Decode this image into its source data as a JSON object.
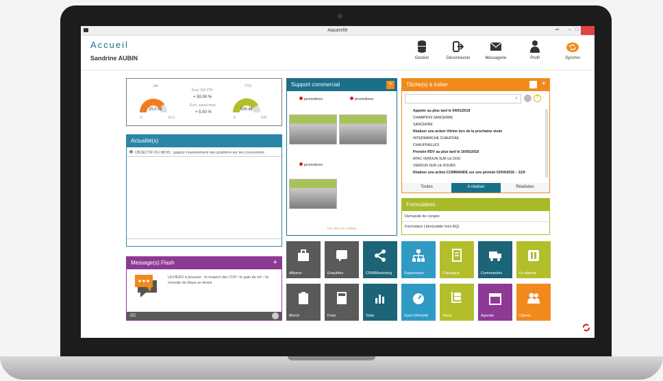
{
  "window": {
    "title": "Aquarelle"
  },
  "header": {
    "title": "Accueil",
    "user": "Sandrine AUBIN"
  },
  "toolbar": [
    {
      "label": "Gestion",
      "icon": "database-icon"
    },
    {
      "label": "Déconnexion",
      "icon": "logout-icon"
    },
    {
      "label": "Messagerie",
      "icon": "mail-icon"
    },
    {
      "label": "Profil",
      "icon": "user-icon"
    },
    {
      "label": "Synchro",
      "icon": "sync-icon"
    }
  ],
  "gauges": {
    "left": {
      "top_label": "14k",
      "value": "25.0 k€",
      "min": "0",
      "max": "31.0",
      "fraction": 0.8,
      "color": "#f07c1f"
    },
    "middle": {
      "ca_label": "Évol. CA YTD",
      "ca_value": "+ 50.00 %",
      "cumul_label": "Évol. cumul mois",
      "cumul_value": "+ 5.00 %"
    },
    "right": {
      "top_label": "YTD",
      "value": "500 k€",
      "min": "0",
      "max": "610",
      "fraction": 0.82,
      "color": "#b2bf2a"
    }
  },
  "news": {
    "title": "Actualité(s)",
    "items": [
      "OBJECTIF DU MOIS : gagner massivement des positions sur les concurrents"
    ]
  },
  "flash": {
    "title": "Message(s) Flash",
    "text": "LEVIERS à pousser : le respect des TOP / le gain de ref. / la réussite de Mass en Avant",
    "footer": "DC",
    "add": "+"
  },
  "support": {
    "title": "Support commercial",
    "badge": "6",
    "items": [
      "promotions",
      "promotions",
      "promotions"
    ],
    "more": "Voir plus de médias"
  },
  "tasks": {
    "title": "Tâche(s) à traiter",
    "add": "+",
    "search_placeholder": "",
    "lines": [
      {
        "text": "Appeler  au plus tard le 04/01/2018",
        "bold": true
      },
      {
        "text": "CHAMPION SANCERRE",
        "bold": false
      },
      {
        "text": "SANCERRE",
        "bold": false
      },
      {
        "text": "Réaliser une action  Vitrine lors de la prochaine visite",
        "bold": true
      },
      {
        "text": "INTERMARCHE CHAUFFAIL",
        "bold": false
      },
      {
        "text": "CHAUFFAILLES",
        "bold": false
      },
      {
        "text": "Prendre RDV  au plus tard le 16/05/2018",
        "bold": true
      },
      {
        "text": "ATAC VERDUN SUR LE DOU",
        "bold": false
      },
      {
        "text": "VERDUN SUR LE DOUBS",
        "bold": false
      },
      {
        "text": "Réaliser une action  COMMANDE sur une période 02/04/2018 – 31/0",
        "bold": true
      }
    ],
    "tabs": [
      "Toutes",
      "A réaliser",
      "Réalisées"
    ]
  },
  "forms": {
    "title": "Formulaires",
    "items": [
      "Demande de congés",
      "Formulaire Libre(valide hors AQ)"
    ]
  },
  "tiles": [
    {
      "label": "Affaires",
      "color": "#5a5a5a",
      "icon": "briefcase-icon"
    },
    {
      "label": "Enquêtes",
      "color": "#5a5a5a",
      "icon": "survey-icon"
    },
    {
      "label": "CRM/Marketing",
      "color": "#1c6478",
      "icon": "share-icon"
    },
    {
      "label": "Supervision",
      "color": "#2f9ac4",
      "icon": "org-chart-icon"
    },
    {
      "label": "Catalogue",
      "color": "#b2bf2a",
      "icon": "catalog-icon"
    },
    {
      "label": "Commandes",
      "color": "#1c6478",
      "icon": "truck-icon"
    },
    {
      "label": "En attente",
      "color": "#b2bf2a",
      "icon": "pause-icon"
    },
    {
      "label": "Merch",
      "color": "#5a5a5a",
      "icon": "clipboard-icon"
    },
    {
      "label": "Frais",
      "color": "#5a5a5a",
      "icon": "calculator-icon"
    },
    {
      "label": "Stats",
      "color": "#1c6478",
      "icon": "bar-chart-icon"
    },
    {
      "label": "Suivi d'Activité",
      "color": "#2f9ac4",
      "icon": "dashboard-icon"
    },
    {
      "label": "Stock",
      "color": "#b2bf2a",
      "icon": "hand-truck-icon"
    },
    {
      "label": "Agenda",
      "color": "#8e3a94",
      "icon": "calendar-icon"
    },
    {
      "label": "Clients",
      "color": "#f08a1c",
      "icon": "users-icon"
    }
  ],
  "colors": {
    "accent": "#1a6f89",
    "orange": "#f08a1c",
    "green": "#a9ba28",
    "purple": "#8e3a94"
  }
}
